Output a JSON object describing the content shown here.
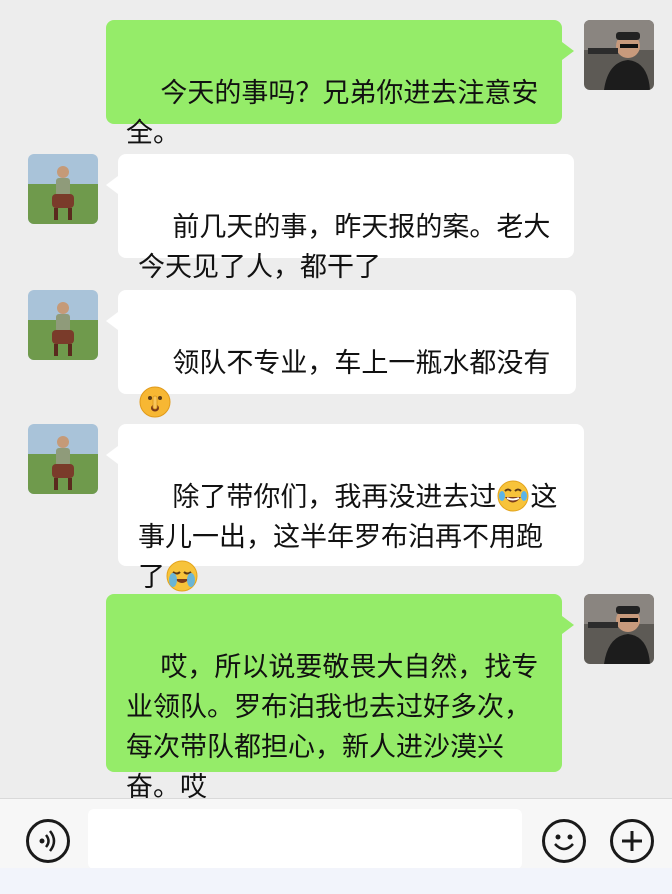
{
  "messages": [
    {
      "sender": "me",
      "text": "今天的事吗？兄弟你进去注意安全。"
    },
    {
      "sender": "friend",
      "text": "前几天的事，昨天报的案。老大今天见了人，都干了"
    },
    {
      "sender": "friend",
      "text_parts": [
        "领队不专业，车上一瓶水都没有",
        ""
      ],
      "emojis": [
        "shushing-face-emoji"
      ]
    },
    {
      "sender": "friend",
      "text_parts": [
        "除了带你们，我再没进去过",
        "这事儿一出，这半年罗布泊再不用跑了",
        ""
      ],
      "emojis": [
        "tears-of-joy-emoji",
        "crying-laughing-emoji"
      ]
    },
    {
      "sender": "me",
      "text": "哎，所以说要敬畏大自然，找专业领队。罗布泊我也去过好多次，每次带队都担心，新人进沙漠兴奋。哎"
    }
  ],
  "input": {
    "value": "",
    "placeholder": ""
  },
  "icons": {
    "voice": "voice-icon",
    "emoji": "emoji-icon",
    "plus": "plus-icon"
  },
  "colors": {
    "background": "#ededed",
    "outgoing_bubble": "#95ec69",
    "incoming_bubble": "#ffffff"
  }
}
